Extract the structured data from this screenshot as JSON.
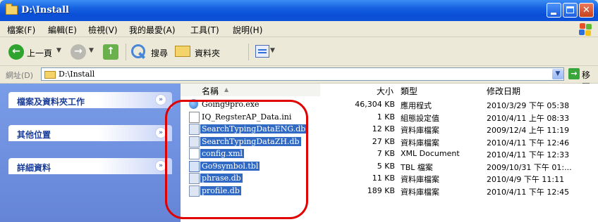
{
  "window": {
    "title": "D:\\Install",
    "min": "_",
    "max": "□",
    "close": "✕"
  },
  "menu": [
    "檔案(F)",
    "編輯(E)",
    "檢視(V)",
    "我的最愛(A)",
    "工具(T)",
    "說明(H)"
  ],
  "toolbar": {
    "back_label": "上一頁",
    "search_label": "搜尋",
    "folders_label": "資料夾"
  },
  "address": {
    "label": "網址(D)",
    "path": "D:\\Install",
    "go_label": "移至"
  },
  "tasks": [
    "檔案及資料夾工作",
    "其他位置",
    "詳細資料"
  ],
  "columns": {
    "name": "名稱",
    "size": "大小",
    "type": "類型",
    "modified": "修改日期"
  },
  "files": [
    {
      "name": "Going9pro.exe",
      "size": "46,304 KB",
      "type": "應用程式",
      "modified": "2010/3/29 下午 05:38",
      "selected": false,
      "icon": "exe"
    },
    {
      "name": "IQ_RegsterAP_Data.ini",
      "size": "1 KB",
      "type": "組態設定值",
      "modified": "2010/4/11 上午 08:33",
      "selected": false,
      "icon": "ini"
    },
    {
      "name": "SearchTypingDataENG.db",
      "size": "12 KB",
      "type": "資料庫檔案",
      "modified": "2009/12/4 上午 11:19",
      "selected": true,
      "icon": "db"
    },
    {
      "name": "SearchTypingDataZH.db",
      "size": "27 KB",
      "type": "資料庫檔案",
      "modified": "2010/4/11 下午 12:46",
      "selected": true,
      "icon": "db"
    },
    {
      "name": "config.xml",
      "size": "7 KB",
      "type": "XML Document",
      "modified": "2010/4/11 下午 12:33",
      "selected": true,
      "icon": "xml"
    },
    {
      "name": "Go9symbol.tbl",
      "size": "5 KB",
      "type": "TBL 檔案",
      "modified": "2009/10/31 下午 01:...",
      "selected": true,
      "icon": "tbl"
    },
    {
      "name": "phrase.db",
      "size": "11 KB",
      "type": "資料庫檔案",
      "modified": "2010/4/9 下午 11:11",
      "selected": true,
      "icon": "db"
    },
    {
      "name": "profile.db",
      "size": "189 KB",
      "type": "資料庫檔案",
      "modified": "2010/4/11 下午 12:45",
      "selected": true,
      "icon": "db"
    }
  ]
}
